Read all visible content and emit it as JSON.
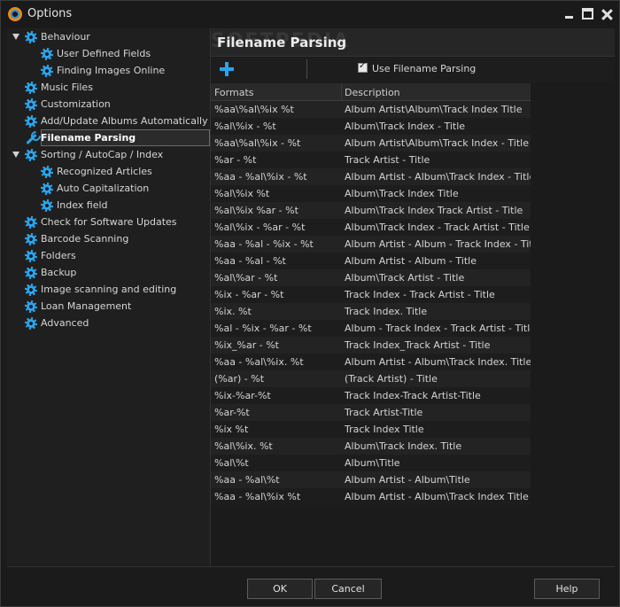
{
  "window": {
    "title": "Options"
  },
  "watermark": "SOFTPEDIA",
  "tree": {
    "items": [
      {
        "label": "Behaviour",
        "level": 0,
        "icon": "gear-icon",
        "expanded": true
      },
      {
        "label": "User Defined Fields",
        "level": 1,
        "icon": "gear-icon"
      },
      {
        "label": "Finding Images Online",
        "level": 1,
        "icon": "gear-icon"
      },
      {
        "label": "Music Files",
        "level": 0,
        "icon": "gear-icon"
      },
      {
        "label": "Customization",
        "level": 0,
        "icon": "gear-icon"
      },
      {
        "label": "Add/Update Albums Automatically",
        "level": 0,
        "icon": "gear-icon"
      },
      {
        "label": "Filename Parsing",
        "level": 0,
        "icon": "wrench-icon",
        "selected": true
      },
      {
        "label": "Sorting / AutoCap / Index",
        "level": 0,
        "icon": "gear-icon",
        "expanded": true
      },
      {
        "label": "Recognized Articles",
        "level": 1,
        "icon": "gear-icon"
      },
      {
        "label": "Auto Capitalization",
        "level": 1,
        "icon": "gear-icon"
      },
      {
        "label": "Index field",
        "level": 1,
        "icon": "gear-icon"
      },
      {
        "label": "Check for Software Updates",
        "level": 0,
        "icon": "gear-icon"
      },
      {
        "label": "Barcode Scanning",
        "level": 0,
        "icon": "gear-icon"
      },
      {
        "label": "Folders",
        "level": 0,
        "icon": "gear-icon"
      },
      {
        "label": "Backup",
        "level": 0,
        "icon": "gear-icon"
      },
      {
        "label": "Image scanning and editing",
        "level": 0,
        "icon": "gear-icon"
      },
      {
        "label": "Loan Management",
        "level": 0,
        "icon": "gear-icon"
      },
      {
        "label": "Advanced",
        "level": 0,
        "icon": "gear-icon"
      }
    ]
  },
  "panel": {
    "title": "Filename Parsing",
    "use_parsing_label": "Use Filename Parsing",
    "use_parsing_checked": true
  },
  "grid": {
    "headers": [
      "Formats",
      "Description"
    ],
    "rows": [
      [
        "%aa\\%al\\%ix %t",
        "Album Artist\\Album\\Track Index Title"
      ],
      [
        "%al\\%ix - %t",
        "Album\\Track Index - Title"
      ],
      [
        "%aa\\%al\\%ix - %t",
        "Album Artist\\Album\\Track Index - Title"
      ],
      [
        "%ar - %t",
        "Track Artist - Title"
      ],
      [
        "%aa - %al\\%ix - %t",
        "Album Artist - Album\\Track Index - Title"
      ],
      [
        "%al\\%ix %t",
        "Album\\Track Index Title"
      ],
      [
        "%al\\%ix %ar - %t",
        "Album\\Track Index Track Artist - Title"
      ],
      [
        "%al\\%ix - %ar - %t",
        "Album\\Track Index - Track Artist - Title"
      ],
      [
        "%aa - %al - %ix - %t",
        "Album Artist - Album - Track Index - Title"
      ],
      [
        "%aa - %al - %t",
        "Album Artist - Album - Title"
      ],
      [
        "%al\\%ar - %t",
        "Album\\Track Artist - Title"
      ],
      [
        "%ix - %ar - %t",
        "Track Index - Track Artist - Title"
      ],
      [
        "%ix. %t",
        "Track Index. Title"
      ],
      [
        "%al - %ix - %ar - %t",
        "Album - Track Index - Track Artist - Title"
      ],
      [
        "%ix_%ar - %t",
        "Track Index_Track Artist - Title"
      ],
      [
        "%aa - %al\\%ix. %t",
        "Album Artist - Album\\Track Index. Title"
      ],
      [
        "(%ar) - %t",
        "(Track Artist) - Title"
      ],
      [
        "%ix-%ar-%t",
        "Track Index-Track Artist-Title"
      ],
      [
        "%ar-%t",
        "Track Artist-Title"
      ],
      [
        "%ix %t",
        "Track Index Title"
      ],
      [
        "%al\\%ix. %t",
        "Album\\Track Index. Title"
      ],
      [
        "%al\\%t",
        "Album\\Title"
      ],
      [
        "%aa - %al\\%t",
        "Album Artist - Album\\Title"
      ],
      [
        "%aa - %al\\%ix %t",
        "Album Artist - Album\\Track Index Title"
      ]
    ]
  },
  "footer": {
    "ok": "OK",
    "cancel": "Cancel",
    "help": "Help"
  },
  "colors": {
    "accent": "#2aa4ec",
    "background": "#1b1b1b"
  }
}
